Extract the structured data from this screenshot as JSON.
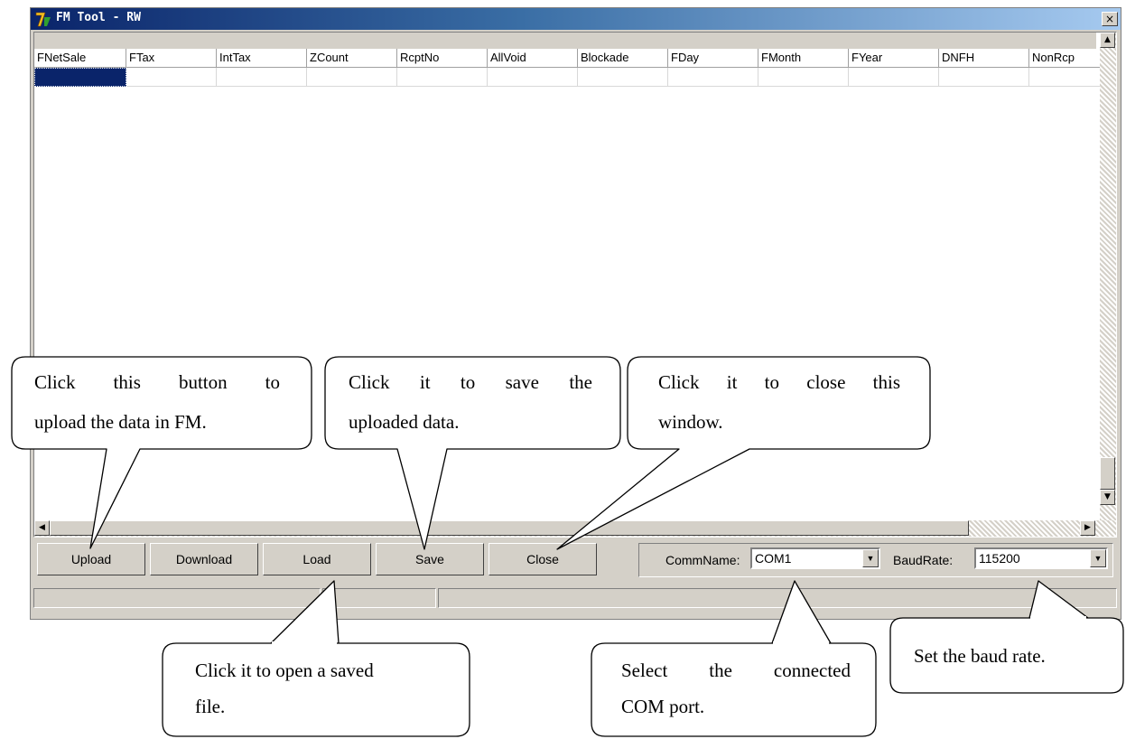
{
  "window": {
    "title": "FM Tool - RW",
    "close_glyph": "×"
  },
  "grid": {
    "columns": [
      "FNetSale",
      "FTax",
      "IntTax",
      "ZCount",
      "RcptNo",
      "AllVoid",
      "Blockade",
      "FDay",
      "FMonth",
      "FYear",
      "DNFH",
      "NonRcp"
    ]
  },
  "toolbar": {
    "upload_label": "Upload",
    "download_label": "Download",
    "load_label": "Load",
    "save_label": "Save",
    "close_label": "Close",
    "commname_label": "CommName:",
    "commname_value": "COM1",
    "baudrate_label": "BaudRate:",
    "baudrate_value": "115200"
  },
  "callouts": {
    "upload": {
      "line1": "Click this button to",
      "line2": "upload the data in FM."
    },
    "save": {
      "line1": "Click it to save the",
      "line2": "uploaded data."
    },
    "close": {
      "line1": "Click it to close this",
      "line2": "window."
    },
    "load": {
      "line1": "Click it to open a saved",
      "line2": "file."
    },
    "com": {
      "line1": "Select the connected",
      "line2": "COM port."
    },
    "baud": {
      "line1": "Set the baud rate."
    }
  },
  "icons": {
    "app": "app-icon",
    "scroll_up": "▲",
    "scroll_down": "▼",
    "scroll_left": "◀",
    "scroll_right": "▶",
    "dropdown": "▼"
  },
  "colors": {
    "titlebar_start": "#0a246a",
    "titlebar_end": "#a6caf0",
    "window_face": "#d4d0c8",
    "selection": "#0a246a"
  }
}
